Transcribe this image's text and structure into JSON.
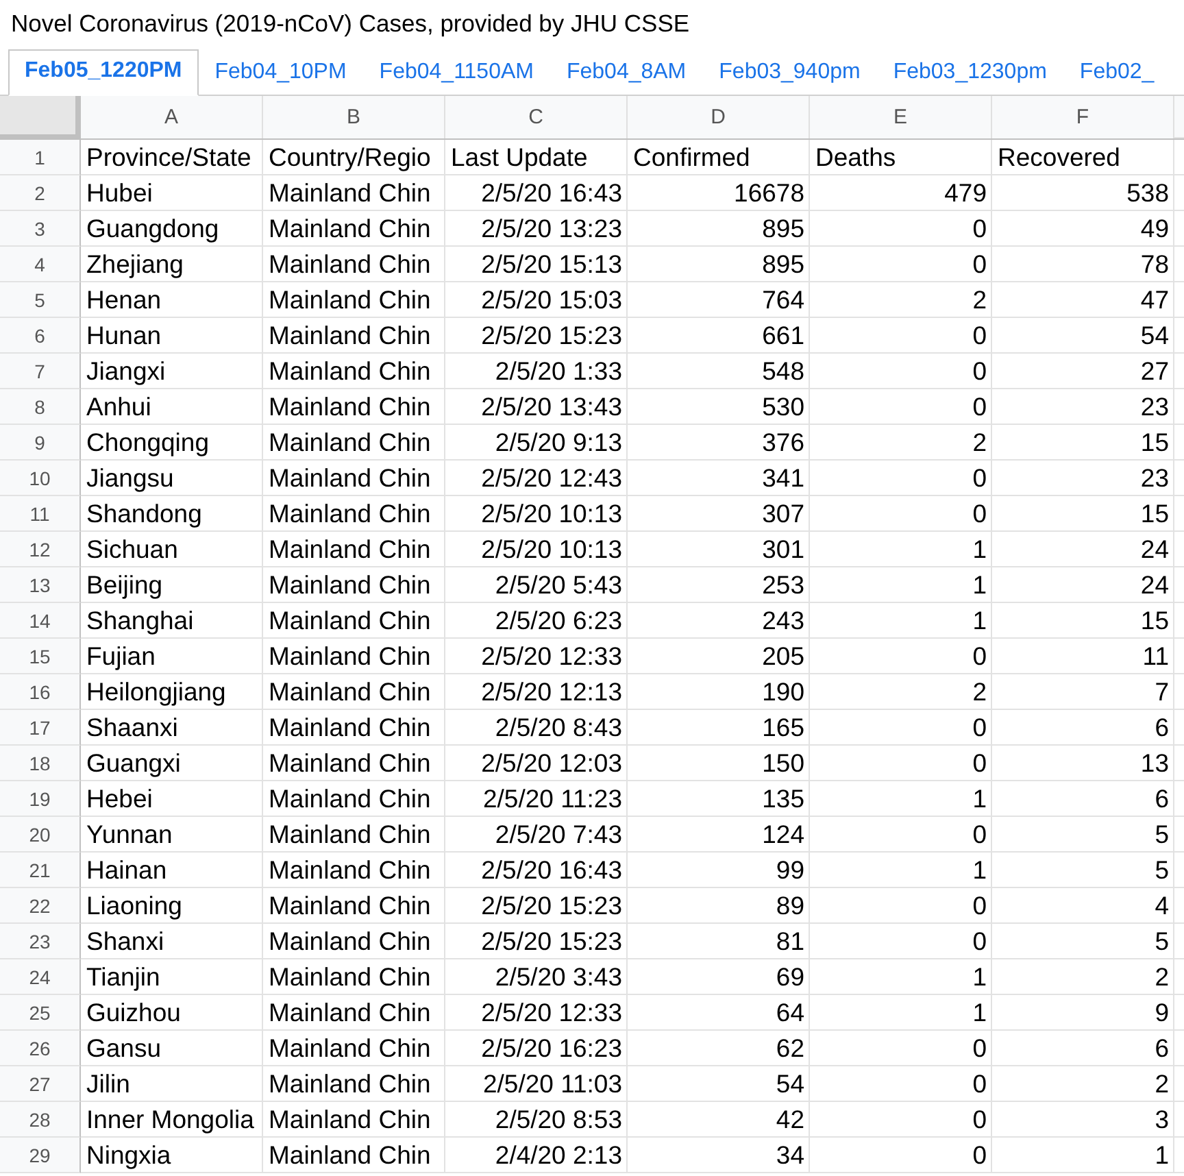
{
  "title": "Novel Coronavirus (2019-nCoV) Cases, provided by JHU CSSE",
  "tabs": [
    {
      "label": "Feb05_1220PM",
      "selected": true
    },
    {
      "label": "Feb04_10PM",
      "selected": false
    },
    {
      "label": "Feb04_1150AM",
      "selected": false
    },
    {
      "label": "Feb04_8AM",
      "selected": false
    },
    {
      "label": "Feb03_940pm",
      "selected": false
    },
    {
      "label": "Feb03_1230pm",
      "selected": false
    },
    {
      "label": "Feb02_",
      "selected": false
    }
  ],
  "columns": [
    "A",
    "B",
    "C",
    "D",
    "E",
    "F"
  ],
  "rows": [
    {
      "number": "1",
      "cells": [
        "Province/State",
        "Country/Regio",
        "Last Update",
        "Confirmed",
        "Deaths",
        "Recovered"
      ]
    },
    {
      "number": "2",
      "cells": [
        "Hubei",
        "Mainland Chin",
        "2/5/20 16:43",
        "16678",
        "479",
        "538"
      ]
    },
    {
      "number": "3",
      "cells": [
        "Guangdong",
        "Mainland Chin",
        "2/5/20 13:23",
        "895",
        "0",
        "49"
      ]
    },
    {
      "number": "4",
      "cells": [
        "Zhejiang",
        "Mainland Chin",
        "2/5/20 15:13",
        "895",
        "0",
        "78"
      ]
    },
    {
      "number": "5",
      "cells": [
        "Henan",
        "Mainland Chin",
        "2/5/20 15:03",
        "764",
        "2",
        "47"
      ]
    },
    {
      "number": "6",
      "cells": [
        "Hunan",
        "Mainland Chin",
        "2/5/20 15:23",
        "661",
        "0",
        "54"
      ]
    },
    {
      "number": "7",
      "cells": [
        "Jiangxi",
        "Mainland Chin",
        "2/5/20 1:33",
        "548",
        "0",
        "27"
      ]
    },
    {
      "number": "8",
      "cells": [
        "Anhui",
        "Mainland Chin",
        "2/5/20 13:43",
        "530",
        "0",
        "23"
      ]
    },
    {
      "number": "9",
      "cells": [
        "Chongqing",
        "Mainland Chin",
        "2/5/20 9:13",
        "376",
        "2",
        "15"
      ]
    },
    {
      "number": "10",
      "cells": [
        "Jiangsu",
        "Mainland Chin",
        "2/5/20 12:43",
        "341",
        "0",
        "23"
      ]
    },
    {
      "number": "11",
      "cells": [
        "Shandong",
        "Mainland Chin",
        "2/5/20 10:13",
        "307",
        "0",
        "15"
      ]
    },
    {
      "number": "12",
      "cells": [
        "Sichuan",
        "Mainland Chin",
        "2/5/20 10:13",
        "301",
        "1",
        "24"
      ]
    },
    {
      "number": "13",
      "cells": [
        "Beijing",
        "Mainland Chin",
        "2/5/20 5:43",
        "253",
        "1",
        "24"
      ]
    },
    {
      "number": "14",
      "cells": [
        "Shanghai",
        "Mainland Chin",
        "2/5/20 6:23",
        "243",
        "1",
        "15"
      ]
    },
    {
      "number": "15",
      "cells": [
        "Fujian",
        "Mainland Chin",
        "2/5/20 12:33",
        "205",
        "0",
        "11"
      ]
    },
    {
      "number": "16",
      "cells": [
        "Heilongjiang",
        "Mainland Chin",
        "2/5/20 12:13",
        "190",
        "2",
        "7"
      ]
    },
    {
      "number": "17",
      "cells": [
        "Shaanxi",
        "Mainland Chin",
        "2/5/20 8:43",
        "165",
        "0",
        "6"
      ]
    },
    {
      "number": "18",
      "cells": [
        "Guangxi",
        "Mainland Chin",
        "2/5/20 12:03",
        "150",
        "0",
        "13"
      ]
    },
    {
      "number": "19",
      "cells": [
        "Hebei",
        "Mainland Chin",
        "2/5/20 11:23",
        "135",
        "1",
        "6"
      ]
    },
    {
      "number": "20",
      "cells": [
        "Yunnan",
        "Mainland Chin",
        "2/5/20 7:43",
        "124",
        "0",
        "5"
      ]
    },
    {
      "number": "21",
      "cells": [
        "Hainan",
        "Mainland Chin",
        "2/5/20 16:43",
        "99",
        "1",
        "5"
      ]
    },
    {
      "number": "22",
      "cells": [
        "Liaoning",
        "Mainland Chin",
        "2/5/20 15:23",
        "89",
        "0",
        "4"
      ]
    },
    {
      "number": "23",
      "cells": [
        "Shanxi",
        "Mainland Chin",
        "2/5/20 15:23",
        "81",
        "0",
        "5"
      ]
    },
    {
      "number": "24",
      "cells": [
        "Tianjin",
        "Mainland Chin",
        "2/5/20 3:43",
        "69",
        "1",
        "2"
      ]
    },
    {
      "number": "25",
      "cells": [
        "Guizhou",
        "Mainland Chin",
        "2/5/20 12:33",
        "64",
        "1",
        "9"
      ]
    },
    {
      "number": "26",
      "cells": [
        "Gansu",
        "Mainland Chin",
        "2/5/20 16:23",
        "62",
        "0",
        "6"
      ]
    },
    {
      "number": "27",
      "cells": [
        "Jilin",
        "Mainland Chin",
        "2/5/20 11:03",
        "54",
        "0",
        "2"
      ]
    },
    {
      "number": "28",
      "cells": [
        "Inner Mongolia",
        "Mainland Chin",
        "2/5/20 8:53",
        "42",
        "0",
        "3"
      ]
    },
    {
      "number": "29",
      "cells": [
        "Ningxia",
        "Mainland Chin",
        "2/4/20 2:13",
        "34",
        "0",
        "1"
      ]
    }
  ]
}
